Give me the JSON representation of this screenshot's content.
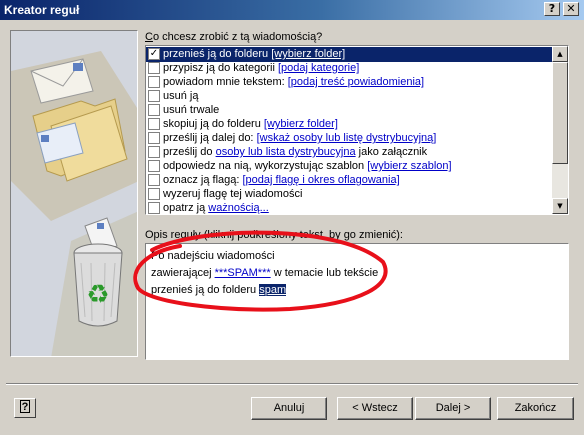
{
  "window": {
    "title": "Kreator reguł",
    "help_glyph": "?",
    "close_glyph": "✕"
  },
  "question": {
    "prefix": "C",
    "rest": "o chcesz zrobić z tą wiadomością?"
  },
  "actions": [
    {
      "checked": true,
      "text": "przenieś ją do folderu ",
      "link": "[wybierz folder]",
      "after": ""
    },
    {
      "checked": false,
      "text": "przypisz ją do kategorii ",
      "link": "[podaj kategorie]",
      "after": ""
    },
    {
      "checked": false,
      "text": "powiadom mnie tekstem: ",
      "link": "[podaj treść powiadomienia]",
      "after": ""
    },
    {
      "checked": false,
      "text": "usuń ją",
      "link": "",
      "after": ""
    },
    {
      "checked": false,
      "text": "usuń trwale",
      "link": "",
      "after": ""
    },
    {
      "checked": false,
      "text": "skopiuj ją do folderu ",
      "link": "[wybierz folder]",
      "after": ""
    },
    {
      "checked": false,
      "text": "prześlij ją dalej do: ",
      "link": "[wskaż osoby lub listę dystrybucyjną]",
      "after": ""
    },
    {
      "checked": false,
      "text": "prześlij do ",
      "link": "osoby lub lista dystrybucyjna",
      "after": " jako załącznik"
    },
    {
      "checked": false,
      "text": "odpowiedz na nią, wykorzystując szablon ",
      "link": "[wybierz szablon]",
      "after": ""
    },
    {
      "checked": false,
      "text": "oznacz ją flagą: ",
      "link": "[podaj flagę i okres oflagowania]",
      "after": ""
    },
    {
      "checked": false,
      "text": "wyzeruj flagę tej wiadomości",
      "link": "",
      "after": ""
    },
    {
      "checked": false,
      "text": "opatrz ją ",
      "link": "ważnością...",
      "after": ""
    }
  ],
  "description": {
    "label": "Opis reguły (kliknij podkreślony tekst, by go zmienić):",
    "line1": "Po nadejściu wiadomości",
    "line2_pre": "zawierającej ",
    "line2_link": "***SPAM***",
    "line2_post": " w temacie lub tekście",
    "line3_pre": "przenieś ją do folderu ",
    "line3_link": "spam"
  },
  "buttons": {
    "help": "?",
    "cancel": "Anuluj",
    "back": "< Wstecz",
    "next": "Dalej >",
    "finish": "Zakończ"
  },
  "scroll": {
    "up": "▲",
    "down": "▼"
  },
  "colors": {
    "titlebar_start": "#0a246a",
    "selection": "#0a246a",
    "link": "#0000c8",
    "annotation": "#e8101a"
  }
}
